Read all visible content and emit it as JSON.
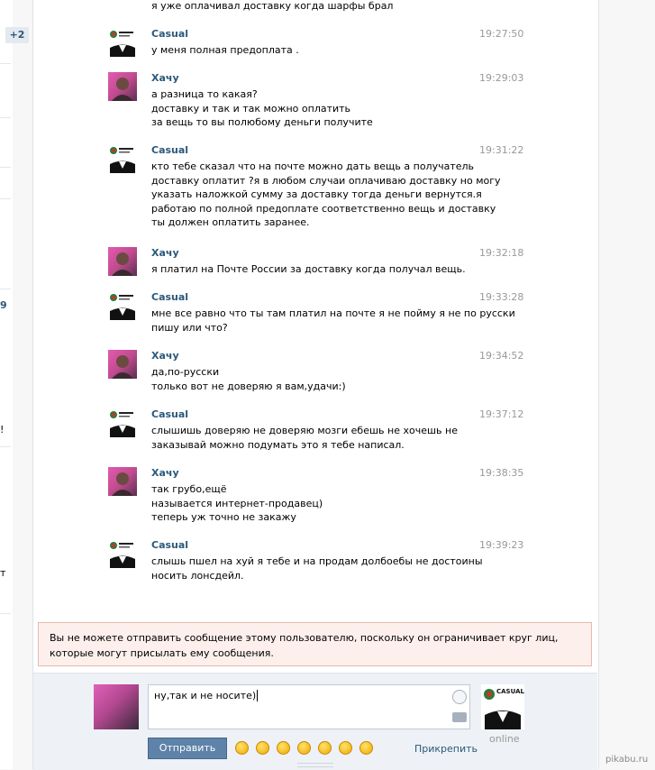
{
  "sidebar": {
    "badge": "+2",
    "frag_9": "9",
    "frag_exclaim": "!",
    "frag_t": "т"
  },
  "top_partial": "я уже оплачивал доставку когда шарфы брал",
  "messages": [
    {
      "author": "Casual",
      "time": "19:27:50",
      "text": "у меня полная предоплата ."
    },
    {
      "author": "Хачу",
      "time": "19:29:03",
      "text": "а разница то какая?\nдоставку и так и так можно оплатить\nза вещь то вы полюбому деньги получите"
    },
    {
      "author": "Casual",
      "time": "19:31:22",
      "text": "кто тебе сказал что на почте можно дать вещь а получатель\nдоставку оплатит ?я в любом случаи оплачиваю доставку но могу\nуказать наложкой сумму за доставку тогда деньги вернутся.я\nработаю по полной предоплате соответственно вещь и доставку\nты должен оплатить заранее."
    },
    {
      "author": "Хачу",
      "time": "19:32:18",
      "text": "я платил на Почте России за доставку когда получал вещь."
    },
    {
      "author": "Casual",
      "time": "19:33:28",
      "text": "мне все равно что ты там платил на почте я не пойму я не по русски\nпишу или что?"
    },
    {
      "author": "Хачу",
      "time": "19:34:52",
      "text": "да,по-русски\nтолько вот не доверяю я вам,удачи:)"
    },
    {
      "author": "Casual",
      "time": "19:37:12",
      "text": "слышишь доверяю не доверяю мозги ебешь не хочешь не\nзаказывай можно подумать это я тебе написал."
    },
    {
      "author": "Хачу",
      "time": "19:38:35",
      "text": "так грубо,ещё\nназывается интернет-продавец)\nтеперь уж точно не закажу"
    },
    {
      "author": "Casual",
      "time": "19:39:23",
      "text": "слышь пшел на хуй я тебе и на продам долбоебы не достоины\nносить лонсдейл."
    }
  ],
  "logo_text": "CASUAL SHOP",
  "warning": "Вы не можете отправить сообщение этому пользователю, поскольку он ограничивает круг лиц, которые могут присылать ему сообщения.",
  "composer": {
    "input_value": "ну,так и не носите)",
    "send_label": "Отправить",
    "attach_label": "Прикрепить",
    "online_label": "online"
  },
  "watermark": "pikabu.ru"
}
